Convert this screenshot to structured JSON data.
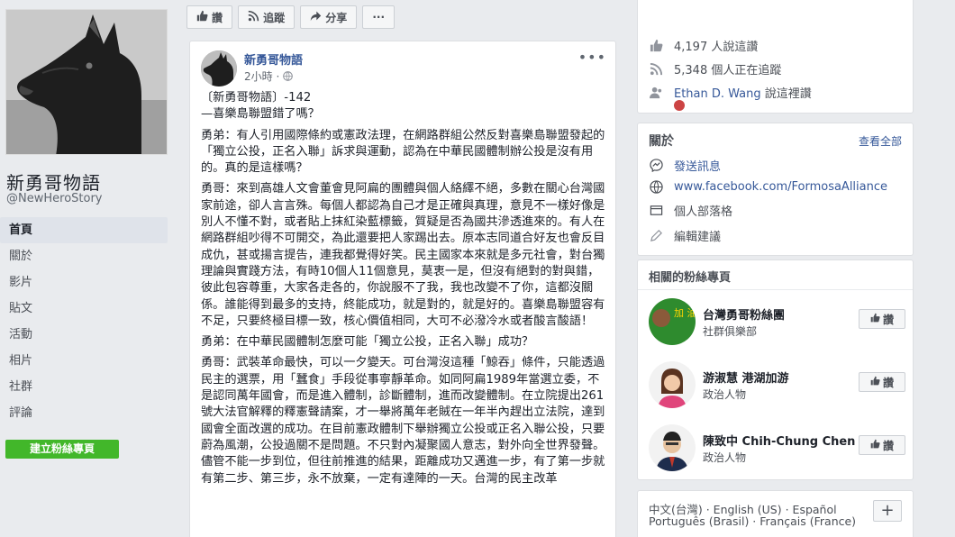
{
  "page": {
    "name": "新勇哥物語",
    "handle": "@NewHeroStory"
  },
  "nav": [
    {
      "label": "首頁",
      "active": true
    },
    {
      "label": "關於"
    },
    {
      "label": "影片"
    },
    {
      "label": "貼文"
    },
    {
      "label": "活動"
    },
    {
      "label": "相片"
    },
    {
      "label": "社群"
    },
    {
      "label": "評論"
    }
  ],
  "create_page_label": "建立粉絲專頁",
  "actionbar": {
    "like": "讚",
    "follow": "追蹤",
    "share": "分享",
    "more": "···"
  },
  "post": {
    "author": "新勇哥物語",
    "time": "2小時",
    "privacy_icon": "globe-icon",
    "more": "•••",
    "paragraphs": [
      "〔新勇哥物語〕-142\n—喜樂島聯盟錯了嗎？",
      "勇弟：有人引用國際條約或憲政法理，在網路群組公然反對喜樂島聯盟發起的「獨立公投，正名入聯」訴求與運動，認為在中華民國體制辦公投是沒有用的。真的是這樣嗎？",
      "勇哥：來到高雄人文會董會見阿扁的團體與個人絡繹不絕，多數在關心台灣國家前途，卻人言言殊。每個人都認為自己才是正確與真理，意見不一樣好像是別人不懂不對，或者貼上抹紅染藍標籤，質疑是否為國共滲透進來的。有人在網路群組吵得不可開交，為此還要把人家踢出去。原本志同道合好友也會反目成仇，甚或揚言提告，連我都覺得好笑。民主國家本來就是多元社會，對台獨理論與實踐方法，有時10個人11個意見，莫衷一是，但沒有絕對的對與錯，彼此包容尊重，大家各走各的，你說服不了我，我也改變不了你，這都沒關係。誰能得到最多的支持，終能成功，就是對的，就是好的。喜樂島聯盟容有不足，只要終極目標一致，核心價值相同，大可不必潑冷水或者酸言酸語！",
      "勇弟：在中華民國體制怎麼可能「獨立公投，正名入聯」成功？",
      "勇哥：武裝革命最快，可以一夕變天。可台灣沒這種「鯨吞」條件，只能透過民主的選票，用「蠶食」手段從事寧靜革命。如同阿扁1989年當選立委，不是認同萬年國會，而是進入體制，診斷體制，進而改變體制。在立院提出261號大法官解釋的釋憲聲請案，才一舉將萬年老賊在一年半內趕出立法院，達到國會全面改選的成功。在目前憲政體制下舉辦獨立公投或正名入聯公投，只要蔚為風潮，公投過關不是問題。不只對內凝聚國人意志，對外向全世界發聲。儘管不能一步到位，但往前推進的結果，距離成功又邁進一步，有了第一步就有第二步、第三步，永不放棄，一定有達陣的一天。台灣的民主改革"
    ]
  },
  "stats": {
    "likes": "4,197 人說這讚",
    "followers": "5,348 個人正在追蹤",
    "friend_name": "Ethan D. Wang",
    "friend_suffix": " 說這裡讚"
  },
  "about": {
    "title": "關於",
    "see_all": "查看全部",
    "items": [
      {
        "icon": "messenger-icon",
        "text": "發送訊息",
        "link": true
      },
      {
        "icon": "globe-icon",
        "text": "www.facebook.com/FormosaAlliance",
        "link": true
      },
      {
        "icon": "blog-icon",
        "text": "個人部落格",
        "link": false
      },
      {
        "icon": "pencil-icon",
        "text": "編輯建議",
        "link": false
      }
    ]
  },
  "related": {
    "title": "相關的粉絲專頁",
    "like_label": "讚",
    "pages": [
      {
        "name": "台灣勇哥粉絲團",
        "category": "社群俱樂部",
        "avatar_text": "加 油"
      },
      {
        "name": "游淑慧 港湖加游",
        "category": "政治人物"
      },
      {
        "name": "陳致中 Chih-Chung Chen",
        "category": "政治人物"
      }
    ]
  },
  "languages": {
    "line1": "中文(台灣) · English (US) · Español",
    "line2": "Português (Brasil) · Français (France)",
    "plus": "+"
  },
  "colors": {
    "background": "#e9ebee",
    "link": "#365899",
    "create_button": "#42b72a"
  }
}
